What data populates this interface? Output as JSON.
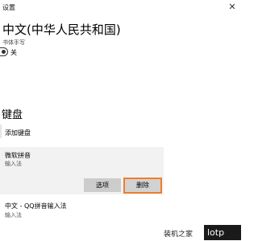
{
  "window": {
    "title": "设置",
    "close_glyph": "✕"
  },
  "header": {
    "title": "中文(中华人民共和国)"
  },
  "handwriting": {
    "label": "书体手写",
    "toggle_state": "关"
  },
  "keyboards": {
    "section_title": "键盘",
    "add_label": "添加键盘",
    "items": [
      {
        "name": "微软拼音",
        "subtitle": "输入法",
        "options_label": "选项",
        "remove_label": "删除"
      },
      {
        "name": "中文 - QQ拼音输入法",
        "subtitle": "输入法"
      }
    ]
  },
  "watermark": {
    "text": "装机之家",
    "logo": "lotp"
  },
  "colors": {
    "focus_border": "#f07c2a",
    "card_bg": "#f2f2f2"
  }
}
